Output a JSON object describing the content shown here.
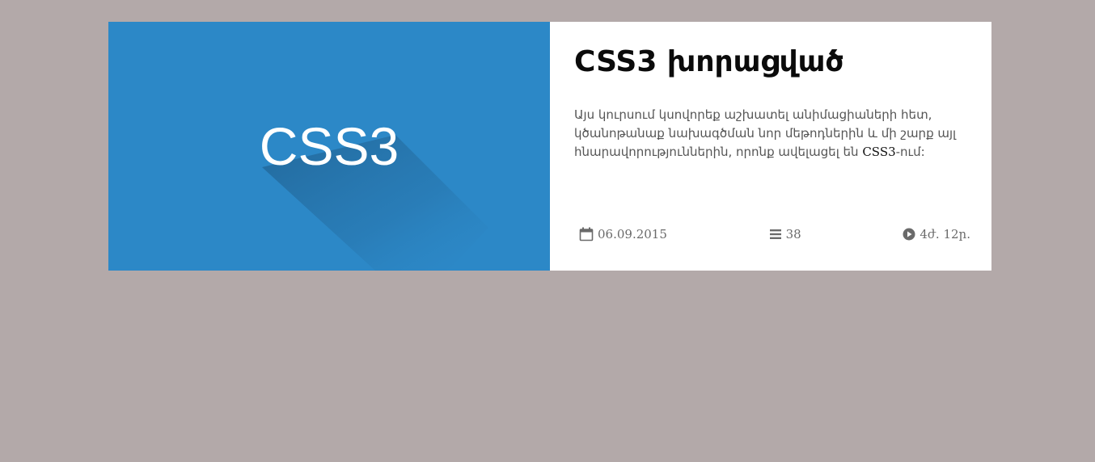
{
  "course": {
    "thumbnail_label": "CSS3",
    "title": "CSS3 խորացված",
    "description_part1": "Այս կուրսում կսովորեք աշխատել անիմացիաների հետ, կծանոթանաք նախագծման նոր մեթոդներին և մի շարք այլ հնարավորություններին, որոնք ավելացել են ",
    "description_latin": "CSS3",
    "description_part2": "-ում:",
    "date": "06.09.2015",
    "lessons_count": "38",
    "duration": "4ժ. 12ր."
  },
  "colors": {
    "page_background": "#b3a9a9",
    "thumbnail_background": "#2c88c7",
    "card_background": "#ffffff",
    "meta_icon": "#6a6a6a"
  },
  "icons": {
    "date": "calendar-icon",
    "lessons": "list-icon",
    "duration": "play-circle-icon"
  }
}
